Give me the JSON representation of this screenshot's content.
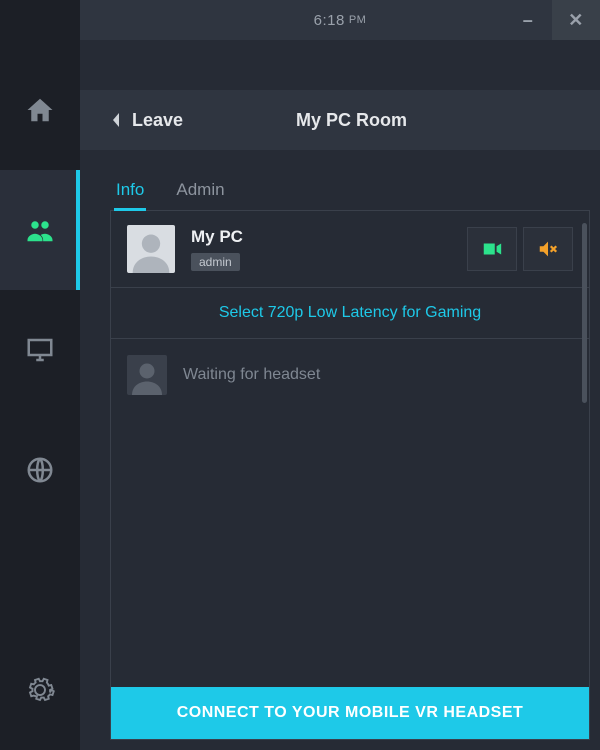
{
  "titlebar": {
    "time": "6:18",
    "ampm": "PM"
  },
  "sidebar": {
    "items": [
      {
        "icon": "home",
        "active": false
      },
      {
        "icon": "users",
        "active": true
      },
      {
        "icon": "monitor",
        "active": false
      },
      {
        "icon": "globe",
        "active": false
      },
      {
        "icon": "gear",
        "active": false
      }
    ]
  },
  "roomheader": {
    "leave_label": "Leave",
    "title": "My PC Room"
  },
  "tabs": {
    "info": "Info",
    "admin": "Admin"
  },
  "user": {
    "name": "My PC",
    "role": "admin"
  },
  "quality_link": "Select 720p Low Latency for Gaming",
  "waiting_text": "Waiting for headset",
  "connect_label": "CONNECT TO YOUR MOBILE VR HEADSET",
  "colors": {
    "accent": "#1ec9e8",
    "active_nav": "#2ce28c",
    "video_icon": "#2ce28c",
    "mute_icon": "#f4a12a"
  }
}
